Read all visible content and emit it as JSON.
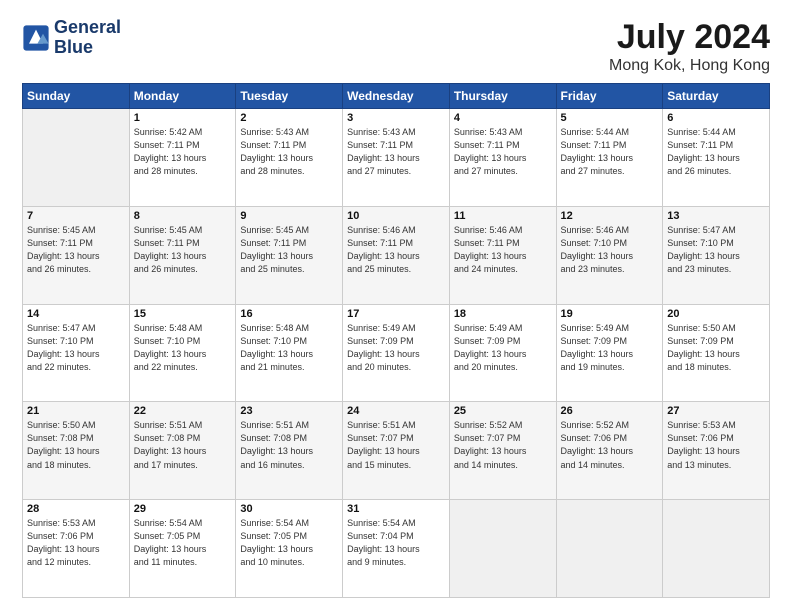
{
  "header": {
    "logo_line1": "General",
    "logo_line2": "Blue",
    "title": "July 2024",
    "subtitle": "Mong Kok, Hong Kong"
  },
  "calendar": {
    "columns": [
      "Sunday",
      "Monday",
      "Tuesday",
      "Wednesday",
      "Thursday",
      "Friday",
      "Saturday"
    ],
    "weeks": [
      [
        {
          "day": "",
          "info": ""
        },
        {
          "day": "1",
          "info": "Sunrise: 5:42 AM\nSunset: 7:11 PM\nDaylight: 13 hours\nand 28 minutes."
        },
        {
          "day": "2",
          "info": "Sunrise: 5:43 AM\nSunset: 7:11 PM\nDaylight: 13 hours\nand 28 minutes."
        },
        {
          "day": "3",
          "info": "Sunrise: 5:43 AM\nSunset: 7:11 PM\nDaylight: 13 hours\nand 27 minutes."
        },
        {
          "day": "4",
          "info": "Sunrise: 5:43 AM\nSunset: 7:11 PM\nDaylight: 13 hours\nand 27 minutes."
        },
        {
          "day": "5",
          "info": "Sunrise: 5:44 AM\nSunset: 7:11 PM\nDaylight: 13 hours\nand 27 minutes."
        },
        {
          "day": "6",
          "info": "Sunrise: 5:44 AM\nSunset: 7:11 PM\nDaylight: 13 hours\nand 26 minutes."
        }
      ],
      [
        {
          "day": "7",
          "info": "Sunrise: 5:45 AM\nSunset: 7:11 PM\nDaylight: 13 hours\nand 26 minutes."
        },
        {
          "day": "8",
          "info": "Sunrise: 5:45 AM\nSunset: 7:11 PM\nDaylight: 13 hours\nand 26 minutes."
        },
        {
          "day": "9",
          "info": "Sunrise: 5:45 AM\nSunset: 7:11 PM\nDaylight: 13 hours\nand 25 minutes."
        },
        {
          "day": "10",
          "info": "Sunrise: 5:46 AM\nSunset: 7:11 PM\nDaylight: 13 hours\nand 25 minutes."
        },
        {
          "day": "11",
          "info": "Sunrise: 5:46 AM\nSunset: 7:11 PM\nDaylight: 13 hours\nand 24 minutes."
        },
        {
          "day": "12",
          "info": "Sunrise: 5:46 AM\nSunset: 7:10 PM\nDaylight: 13 hours\nand 23 minutes."
        },
        {
          "day": "13",
          "info": "Sunrise: 5:47 AM\nSunset: 7:10 PM\nDaylight: 13 hours\nand 23 minutes."
        }
      ],
      [
        {
          "day": "14",
          "info": "Sunrise: 5:47 AM\nSunset: 7:10 PM\nDaylight: 13 hours\nand 22 minutes."
        },
        {
          "day": "15",
          "info": "Sunrise: 5:48 AM\nSunset: 7:10 PM\nDaylight: 13 hours\nand 22 minutes."
        },
        {
          "day": "16",
          "info": "Sunrise: 5:48 AM\nSunset: 7:10 PM\nDaylight: 13 hours\nand 21 minutes."
        },
        {
          "day": "17",
          "info": "Sunrise: 5:49 AM\nSunset: 7:09 PM\nDaylight: 13 hours\nand 20 minutes."
        },
        {
          "day": "18",
          "info": "Sunrise: 5:49 AM\nSunset: 7:09 PM\nDaylight: 13 hours\nand 20 minutes."
        },
        {
          "day": "19",
          "info": "Sunrise: 5:49 AM\nSunset: 7:09 PM\nDaylight: 13 hours\nand 19 minutes."
        },
        {
          "day": "20",
          "info": "Sunrise: 5:50 AM\nSunset: 7:09 PM\nDaylight: 13 hours\nand 18 minutes."
        }
      ],
      [
        {
          "day": "21",
          "info": "Sunrise: 5:50 AM\nSunset: 7:08 PM\nDaylight: 13 hours\nand 18 minutes."
        },
        {
          "day": "22",
          "info": "Sunrise: 5:51 AM\nSunset: 7:08 PM\nDaylight: 13 hours\nand 17 minutes."
        },
        {
          "day": "23",
          "info": "Sunrise: 5:51 AM\nSunset: 7:08 PM\nDaylight: 13 hours\nand 16 minutes."
        },
        {
          "day": "24",
          "info": "Sunrise: 5:51 AM\nSunset: 7:07 PM\nDaylight: 13 hours\nand 15 minutes."
        },
        {
          "day": "25",
          "info": "Sunrise: 5:52 AM\nSunset: 7:07 PM\nDaylight: 13 hours\nand 14 minutes."
        },
        {
          "day": "26",
          "info": "Sunrise: 5:52 AM\nSunset: 7:06 PM\nDaylight: 13 hours\nand 14 minutes."
        },
        {
          "day": "27",
          "info": "Sunrise: 5:53 AM\nSunset: 7:06 PM\nDaylight: 13 hours\nand 13 minutes."
        }
      ],
      [
        {
          "day": "28",
          "info": "Sunrise: 5:53 AM\nSunset: 7:06 PM\nDaylight: 13 hours\nand 12 minutes."
        },
        {
          "day": "29",
          "info": "Sunrise: 5:54 AM\nSunset: 7:05 PM\nDaylight: 13 hours\nand 11 minutes."
        },
        {
          "day": "30",
          "info": "Sunrise: 5:54 AM\nSunset: 7:05 PM\nDaylight: 13 hours\nand 10 minutes."
        },
        {
          "day": "31",
          "info": "Sunrise: 5:54 AM\nSunset: 7:04 PM\nDaylight: 13 hours\nand 9 minutes."
        },
        {
          "day": "",
          "info": ""
        },
        {
          "day": "",
          "info": ""
        },
        {
          "day": "",
          "info": ""
        }
      ]
    ]
  }
}
